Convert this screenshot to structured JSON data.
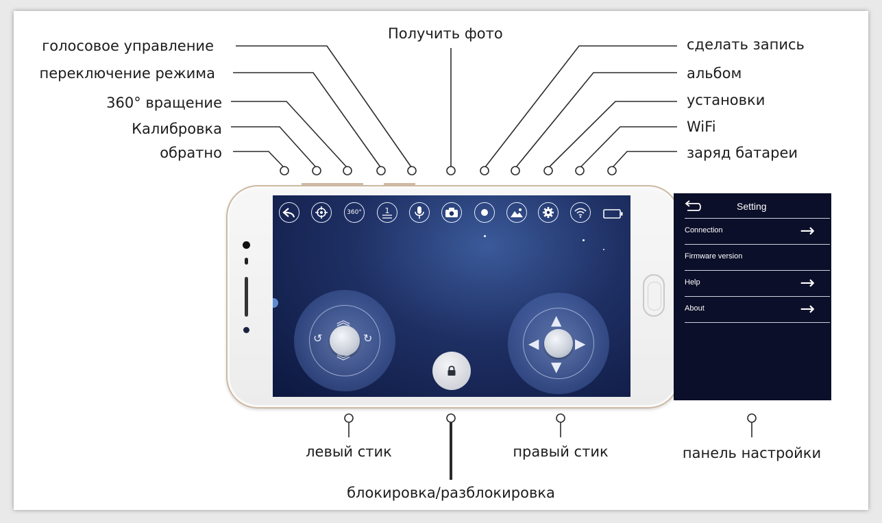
{
  "callouts_top_left": {
    "voice_control": "голосовое управление",
    "mode_switch": "переключение режима",
    "rotation_360": "360°  вращение",
    "calibration": "Калибровка",
    "back": "обратно"
  },
  "callouts_top_center": {
    "get_photo": "Получить фото"
  },
  "callouts_top_right": {
    "record": "сделать запись",
    "album": "альбом",
    "settings": "установки",
    "wifi": "WiFi",
    "battery": "заряд батареи"
  },
  "callouts_bottom": {
    "left_stick": "левый стик",
    "lock_unlock": "блокировка/разблокировка",
    "right_stick": "правый стик",
    "settings_panel": "панель настройки"
  },
  "toolbar": {
    "back_icon": "back-arrow-icon",
    "calibration_icon": "crosshair-icon",
    "rotation_label": "360°",
    "mode_label": "1",
    "voice_icon": "microphone-icon",
    "photo_icon": "camera-icon",
    "record_icon": "record-dot-icon",
    "album_icon": "mountain-image-icon",
    "settings_icon": "gear-icon",
    "wifi_icon": "wifi-icon",
    "battery_icon": "battery-icon"
  },
  "settings_panel": {
    "title": "Setting",
    "items": [
      {
        "label": "Connection",
        "has_arrow": true
      },
      {
        "label": "Firmware version",
        "has_arrow": false
      },
      {
        "label": "Help",
        "has_arrow": true
      },
      {
        "label": "About",
        "has_arrow": true
      }
    ]
  },
  "colors": {
    "screen_bg": "#1e2f63",
    "panel_bg": "#0b0f29",
    "phone_rim": "#cdb9a2",
    "leader_line": "#2a2a2a"
  }
}
